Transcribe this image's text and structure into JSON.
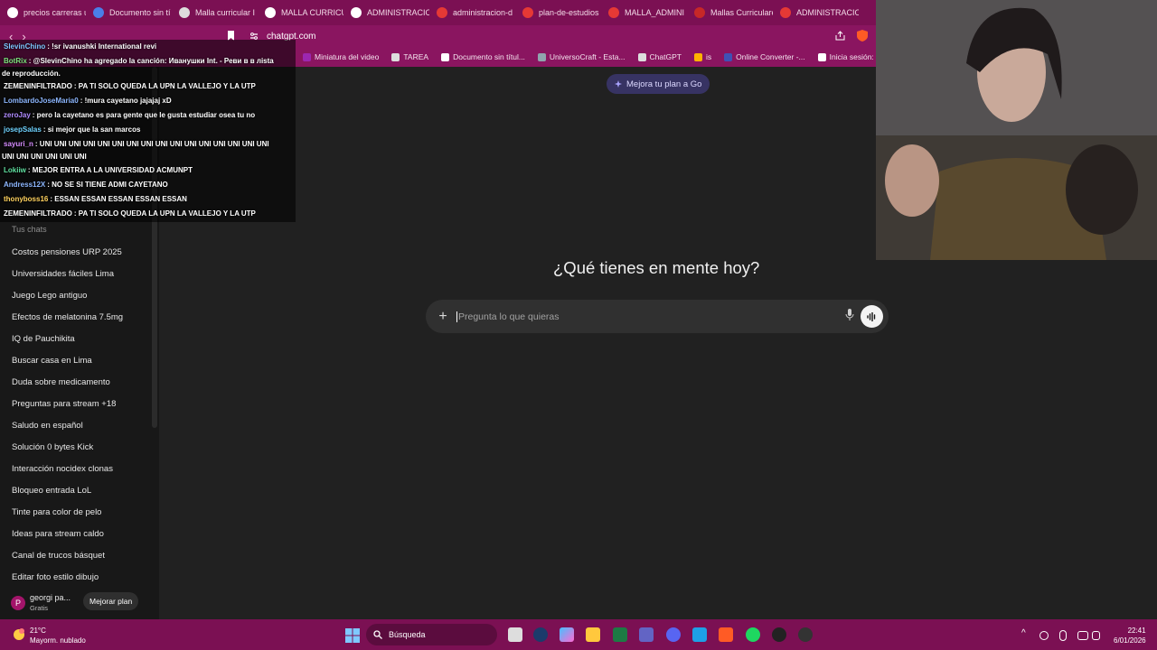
{
  "browser": {
    "tabs": [
      {
        "label": "precios carreras u",
        "icon": "google-icon",
        "color": "#ffffff"
      },
      {
        "label": "Documento sin tí",
        "icon": "docs-icon",
        "color": "#4a7ee8"
      },
      {
        "label": "Malla curricular I",
        "icon": "tab-icon",
        "color": "#dddddd"
      },
      {
        "label": "MALLA CURRICU",
        "icon": "google-icon",
        "color": "#ffffff"
      },
      {
        "label": "ADMINISTRACIO",
        "icon": "google-icon",
        "color": "#ffffff"
      },
      {
        "label": "administracion-d",
        "icon": "pdf-icon",
        "color": "#e53935"
      },
      {
        "label": "plan-de-estudios",
        "icon": "pdf-icon",
        "color": "#e53935"
      },
      {
        "label": "MALLA_ADMINI",
        "icon": "pdf-icon",
        "color": "#e53935"
      },
      {
        "label": "Mallas Curriculare",
        "icon": "shield-icon",
        "color": "#c62828"
      },
      {
        "label": "ADMINISTRACIO",
        "icon": "pdf-icon",
        "color": "#e53935"
      }
    ],
    "url": "chatgpt.com",
    "bookmarks": [
      {
        "label": "Miniatura del video",
        "color": "#9c27b0"
      },
      {
        "label": "TAREA",
        "color": "#dddddd"
      },
      {
        "label": "Documento sin títul...",
        "color": "#ffffff"
      },
      {
        "label": "UniversoCraft - Esta...",
        "color": "#90a4ae"
      },
      {
        "label": "ChatGPT",
        "color": "#dddddd"
      },
      {
        "label": "is",
        "color": "#ffb300"
      },
      {
        "label": "Online Converter -...",
        "color": "#3f51b5"
      },
      {
        "label": "Inicia sesión: Cuer",
        "color": "#ffffff"
      }
    ]
  },
  "stream_chat": [
    {
      "nick": "SlevinChino",
      "nick_color": "#7ec8ff",
      "text": ": !sr ivanushki International revi"
    },
    {
      "nick": "BotRix",
      "nick_color": "#7ee37e",
      "text": ": @SlevinChino ha agregado la canción: Иванушки Int. - Реви в в лista"
    },
    {
      "nick": "",
      "nick_color": "#ffffff",
      "text": "de reproducción."
    },
    {
      "nick": "ZEMENINFILTRADO",
      "nick_color": "#ffffff",
      "text": ": PA TI SOLO QUEDA LA UPN LA VALLEJO Y LA UTP"
    },
    {
      "nick": "LombardoJoseMaria0",
      "nick_color": "#8db7ff",
      "text": ": !mura cayetano jajajaj xD"
    },
    {
      "nick": "zeroJay",
      "nick_color": "#b08bff",
      "text": ": pero la cayetano es para gente que le gusta estudiar osea tu no"
    },
    {
      "nick": "josepSalas",
      "nick_color": "#6fd3ff",
      "text": ": si mejor que la san marcos"
    },
    {
      "nick": "sayuri_n",
      "nick_color": "#d58cff",
      "text": ": UNI UNI UNI UNI UNI UNI UNI UNI UNI UNI UNI UNI UNI UNI UNI UNI"
    },
    {
      "nick": "",
      "nick_color": "#ffffff",
      "text": "UNI UNI UNI UNI UNI UNI"
    },
    {
      "nick": "Lokiiw",
      "nick_color": "#5fe0a0",
      "text": ": MEJOR ENTRA A LA UNIVERSIDAD ACMUNPT"
    },
    {
      "nick": "Andress12X",
      "nick_color": "#8db7ff",
      "text": ": NO SE SI TIENE ADMI CAYETANO"
    },
    {
      "nick": "thonyboss16",
      "nick_color": "#ffd25e",
      "text": ": ESSAN ESSAN ESSAN ESSAN ESSAN"
    },
    {
      "nick": "ZEMENINFILTRADO",
      "nick_color": "#ffffff",
      "text": ": PA TI SOLO QUEDA LA UPN LA VALLEJO Y LA UTP"
    }
  ],
  "sidebar": {
    "section_label": "Tus chats",
    "chats": [
      "Costos pensiones URP 2025",
      "Universidades fáciles Lima",
      "Juego Lego antiguo",
      "Efectos de melatonina 7.5mg",
      "IQ de Pauchikita",
      "Buscar casa en Lima",
      "Duda sobre medicamento",
      "Preguntas para stream +18",
      "Saludo en español",
      "Solución 0 bytes Kick",
      "Interacción nocidex clonas",
      "Bloqueo entrada LoL",
      "Tinte para color de pelo",
      "Ideas para stream caldo",
      "Canal de trucos básquet",
      "Editar foto estilo dibujo"
    ],
    "user": {
      "initial": "P",
      "name": "georgi pa...",
      "plan": "Gratis",
      "upgrade_label": "Mejorar plan"
    }
  },
  "main": {
    "promo_label": "Mejora tu plan a Go",
    "headline": "¿Qué tienes en mente hoy?",
    "input_placeholder": "Pregunta lo que quieras"
  },
  "taskbar": {
    "temperature": "21°C",
    "weather": "Mayorm. nublado",
    "search_label": "Búsqueda",
    "time": "22:41",
    "date": "6/01/2026"
  },
  "colors": {
    "accent": "#7b1053",
    "background": "#212121",
    "sidebar": "#181818"
  }
}
